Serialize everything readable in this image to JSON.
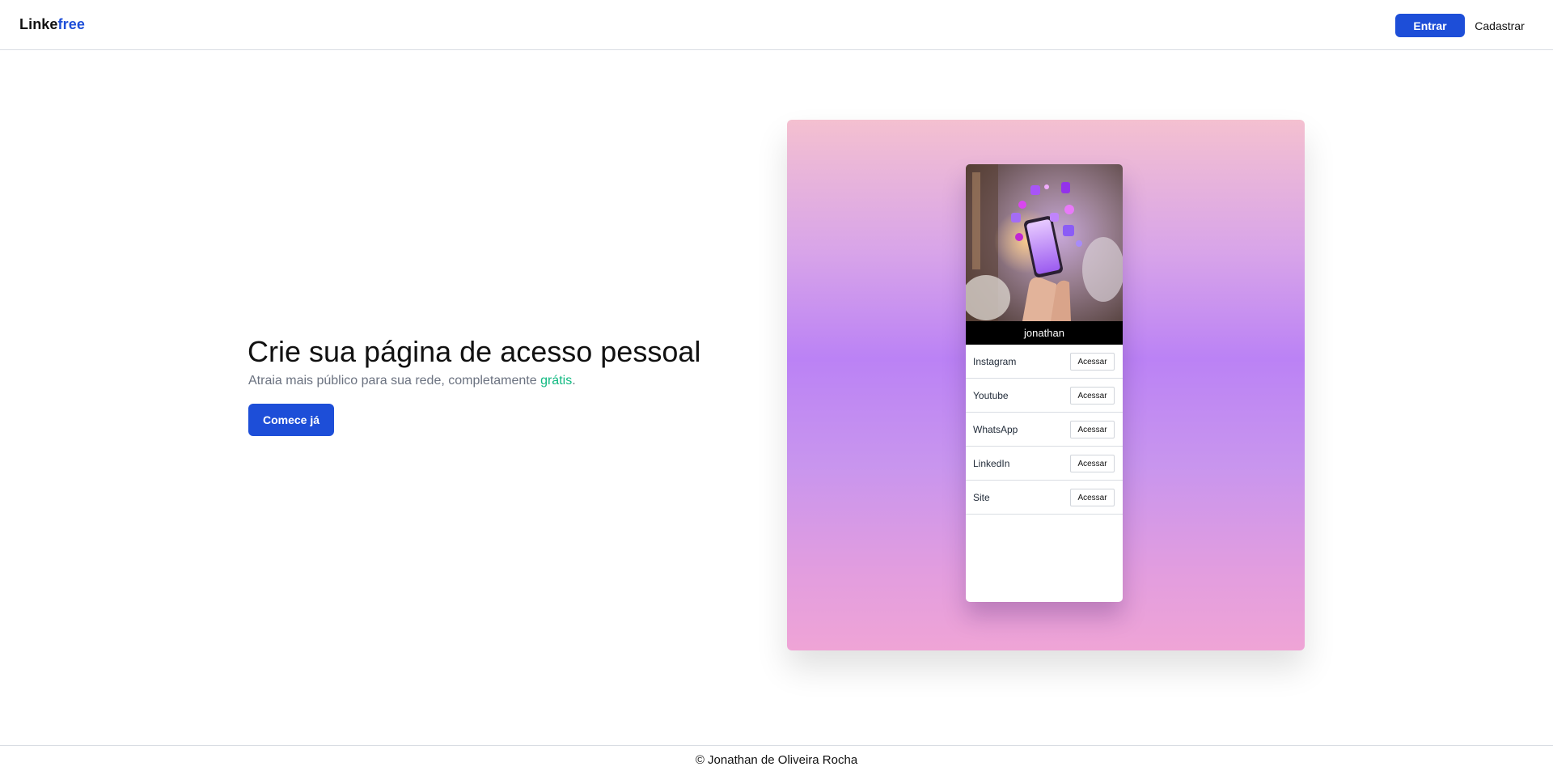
{
  "header": {
    "logo_part1": "Linke",
    "logo_part2": "free",
    "login_label": "Entrar",
    "signup_label": "Cadastrar",
    "brand_color": "#1d4ed8"
  },
  "hero": {
    "title": "Crie sua página de acesso pessoal",
    "subtitle_prefix": "Atraia mais público para sua rede, completamente ",
    "subtitle_highlight": "grátis",
    "subtitle_suffix": ".",
    "cta_label": "Comece já",
    "highlight_color": "#10b981"
  },
  "preview": {
    "image_alt": "hands holding smartphone with social media icons",
    "username": "jonathan",
    "links": [
      {
        "label": "Instagram",
        "action": "Acessar"
      },
      {
        "label": "Youtube",
        "action": "Acessar"
      },
      {
        "label": "WhatsApp",
        "action": "Acessar"
      },
      {
        "label": "LinkedIn",
        "action": "Acessar"
      },
      {
        "label": "Site",
        "action": "Acessar"
      }
    ]
  },
  "footer": {
    "text": "© Jonathan de Oliveira Rocha"
  }
}
